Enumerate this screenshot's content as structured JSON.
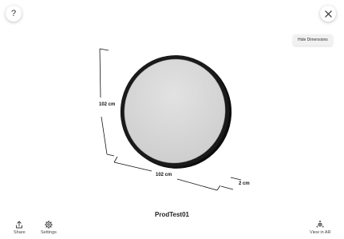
{
  "top_bar": {
    "help_icon": "question-mark-icon",
    "help_label": "?",
    "close_icon": "close-icon",
    "hide_dimensions_label": "Hide Dimensions"
  },
  "dimensions": {
    "height": "102 cm",
    "width": "102 cm",
    "depth": "2 cm"
  },
  "product": {
    "title": "ProdTest01"
  },
  "bottom_bar": {
    "share_label": "Share",
    "share_icon": "share-icon",
    "settings_label": "Settings",
    "settings_icon": "gear-icon",
    "ar_label": "View in AR",
    "ar_icon": "ar-cube-icon"
  },
  "colors": {
    "background": "#ffffff",
    "frame": "#1a1a1a",
    "glass": "#d9d9d9"
  }
}
